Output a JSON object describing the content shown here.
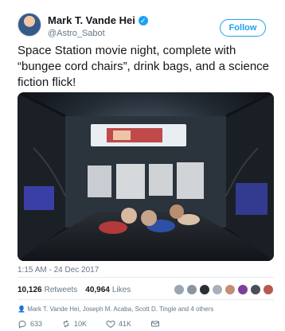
{
  "tweet": {
    "author_name": "Mark T. Vande Hei",
    "handle": "@Astro_Sabot",
    "follow_label": "Follow",
    "text": "Space Station movie night, complete with “bungee cord chairs”, drink bags, and a science fiction flick!",
    "timestamp": "1:15 AM - 24 Dec 2017"
  },
  "stats": {
    "retweets_count": "10,126",
    "retweets_label": "Retweets",
    "likes_count": "40,964",
    "likes_label": "Likes"
  },
  "crew_line": "Mark T. Vande Hei, Joseph M. Acaba, Scott D. Tingle and 4 others",
  "actions": {
    "replies": "633",
    "retweets": "10K",
    "likes": "41K"
  },
  "colors": {
    "accent": "#1da1f2",
    "text_primary": "#14171a",
    "text_secondary": "#657786"
  },
  "icons": [
    "verified-icon",
    "reply-icon",
    "retweet-icon",
    "like-icon",
    "mail-icon"
  ]
}
